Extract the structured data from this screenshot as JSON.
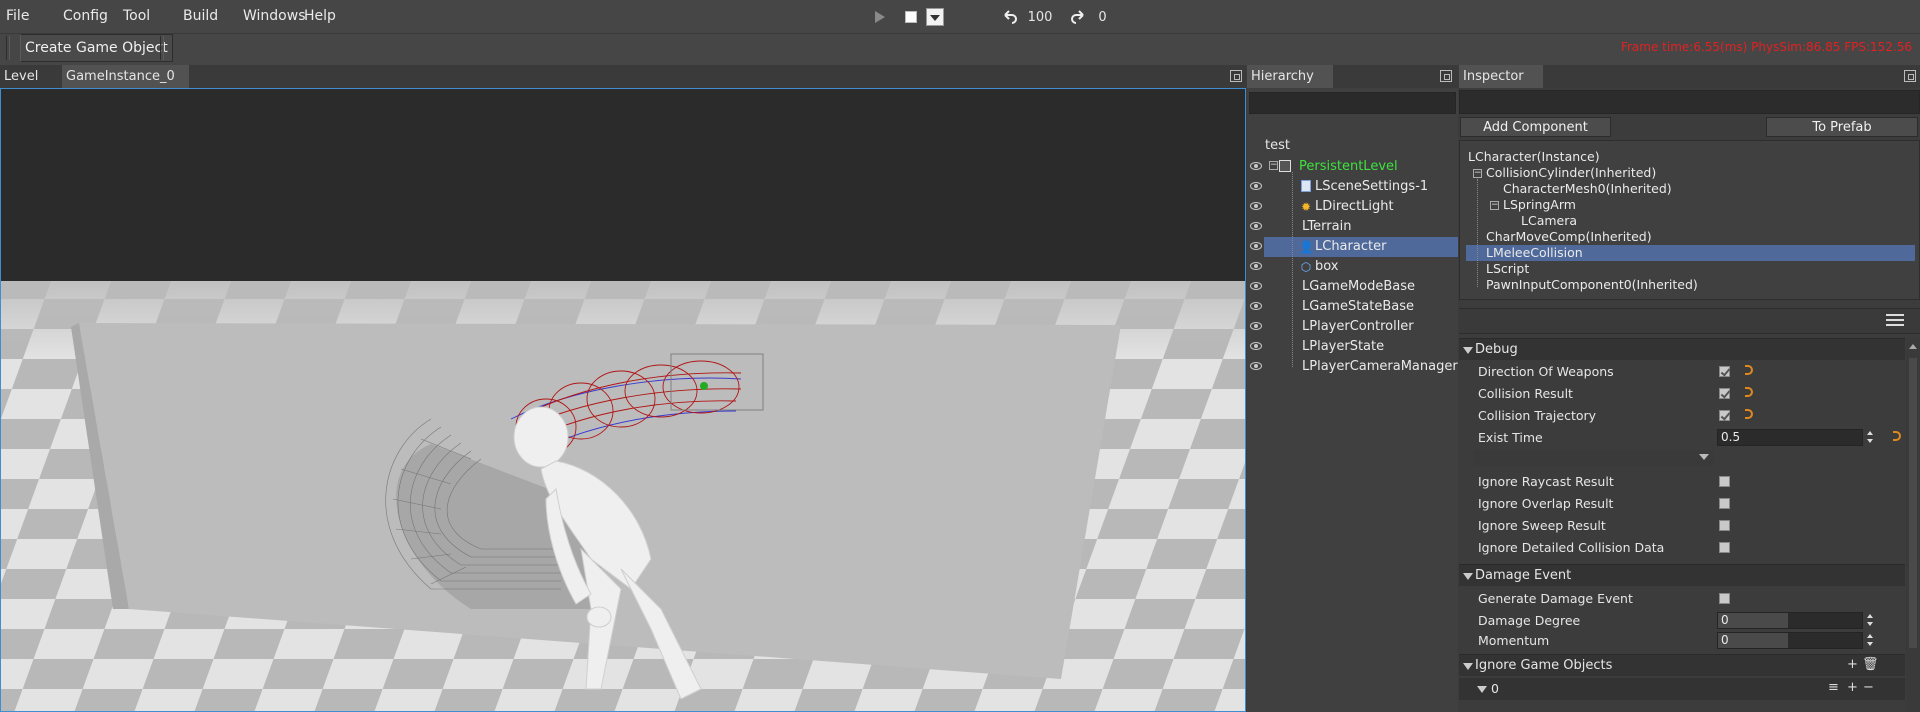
{
  "menu": {
    "file": "File",
    "config": "Config",
    "tool": "Tool",
    "build": "Build",
    "windows": "Windows",
    "help": "Help"
  },
  "toolbar": {
    "undo_count": "100",
    "redo_count": "0"
  },
  "row2": {
    "create_game_object": "Create Game Object",
    "stats": "Frame time:6.55(ms)   PhysSim:86.85   FPS:152.56"
  },
  "tabs": {
    "level": "Level",
    "game_instance": "GameInstance_0",
    "hierarchy": "Hierarchy",
    "inspector": "Inspector"
  },
  "hierarchy": {
    "root": "test",
    "persistent_level": "PersistentLevel",
    "items": [
      {
        "label": "LSceneSettings-1"
      },
      {
        "label": "LDirectLight"
      },
      {
        "label": "LTerrain"
      },
      {
        "label": "LCharacter"
      },
      {
        "label": "box"
      },
      {
        "label": "LGameModeBase"
      },
      {
        "label": "LGameStateBase"
      },
      {
        "label": "LPlayerController"
      },
      {
        "label": "LPlayerState"
      },
      {
        "label": "LPlayerCameraManager"
      }
    ]
  },
  "inspector": {
    "add_component": "Add Component",
    "to_prefab": "To Prefab",
    "components": [
      {
        "label": "LCharacter(Instance)"
      },
      {
        "label": "CollisionCylinder(Inherited)"
      },
      {
        "label": "CharacterMesh0(Inherited)"
      },
      {
        "label": "LSpringArm"
      },
      {
        "label": "LCamera"
      },
      {
        "label": "CharMoveComp(Inherited)"
      },
      {
        "label": "LMeleeCollision"
      },
      {
        "label": "LScript"
      },
      {
        "label": "PawnInputComponent0(Inherited)"
      }
    ],
    "debug": {
      "title": "Debug",
      "direction_of_weapons": "Direction Of Weapons",
      "collision_result": "Collision Result",
      "collision_trajectory": "Collision Trajectory",
      "exist_time": "Exist Time",
      "exist_time_value": "0.5",
      "ignore_raycast": "Ignore Raycast Result",
      "ignore_overlap": "Ignore Overlap Result",
      "ignore_sweep": "Ignore Sweep Result",
      "ignore_detailed": "Ignore Detailed Collision Data"
    },
    "damage": {
      "title": "Damage Event",
      "generate": "Generate Damage Event",
      "degree": "Damage Degree",
      "degree_value": "0",
      "momentum": "Momentum",
      "momentum_value": "0"
    },
    "ignore_objects": {
      "title": "Ignore Game Objects",
      "first": "0"
    }
  },
  "colors": {
    "selection": "#4f6a9a",
    "persistent_level": "#3de23d",
    "stats_red": "#e22121",
    "viewport_border": "#3f8fd0",
    "reset_orange": "#e08a1e"
  }
}
